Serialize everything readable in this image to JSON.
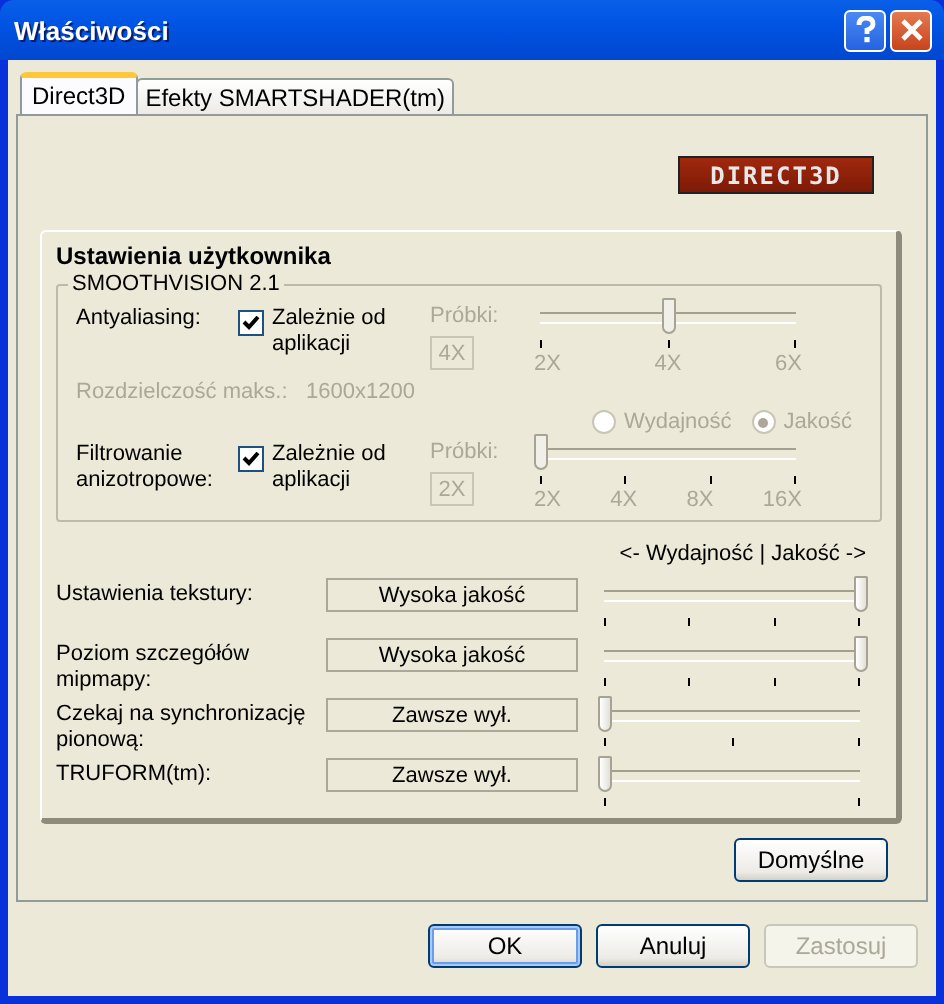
{
  "window": {
    "title": "Właściwości"
  },
  "tabs": [
    {
      "label": "Direct3D",
      "selected": true
    },
    {
      "label": "Efekty SMARTSHADER(tm)",
      "selected": false
    }
  ],
  "logo": "DIRECT3D",
  "user_settings": {
    "title": "Ustawienia użytkownika",
    "smoothvision": {
      "title": "SMOOTHVISION 2.1",
      "antialiasing": {
        "label": "Antyaliasing:",
        "checkbox": {
          "label": "Zależnie od aplikacji",
          "checked": true
        },
        "samples_label": "Próbki:",
        "samples_value": "4X",
        "disabled": true,
        "level": 0.5,
        "ticks": [
          "2X",
          "4X",
          "6X"
        ]
      },
      "max_resolution": {
        "label": "Rozdzielczość maks.:",
        "value": "1600x1200",
        "disabled": true
      },
      "modes": [
        {
          "label": "Wydajność",
          "selected": false,
          "disabled": true
        },
        {
          "label": "Jakość",
          "selected": true,
          "disabled": true
        }
      ],
      "anisotropic": {
        "label": "Filtrowanie anizotropowe:",
        "checkbox": {
          "label": "Zależnie od aplikacji",
          "checked": true
        },
        "samples_label": "Próbki:",
        "samples_value": "2X",
        "disabled": true,
        "level": 0,
        "ticks": [
          "2X",
          "4X",
          "8X",
          "16X"
        ]
      }
    },
    "quality_hint": "<- Wydajność | Jakość ->",
    "settings": [
      {
        "label": "Ustawienia tekstury:",
        "value": "Wysoka jakość",
        "level": 1
      },
      {
        "label": "Poziom szczegółów mipmapy:",
        "value": "Wysoka jakość",
        "level": 1
      },
      {
        "label": "Czekaj na synchronizację pionową:",
        "value": "Zawsze wył.",
        "level": 0
      },
      {
        "label": "TRUFORM(tm):",
        "value": "Zawsze wył.",
        "level": 0
      }
    ],
    "defaults_button": "Domyślne"
  },
  "buttons": [
    {
      "label": "OK",
      "disabled": false,
      "default": true
    },
    {
      "label": "Anuluj",
      "disabled": false,
      "default": false
    },
    {
      "label": "Zastosuj",
      "disabled": true,
      "default": false
    }
  ]
}
